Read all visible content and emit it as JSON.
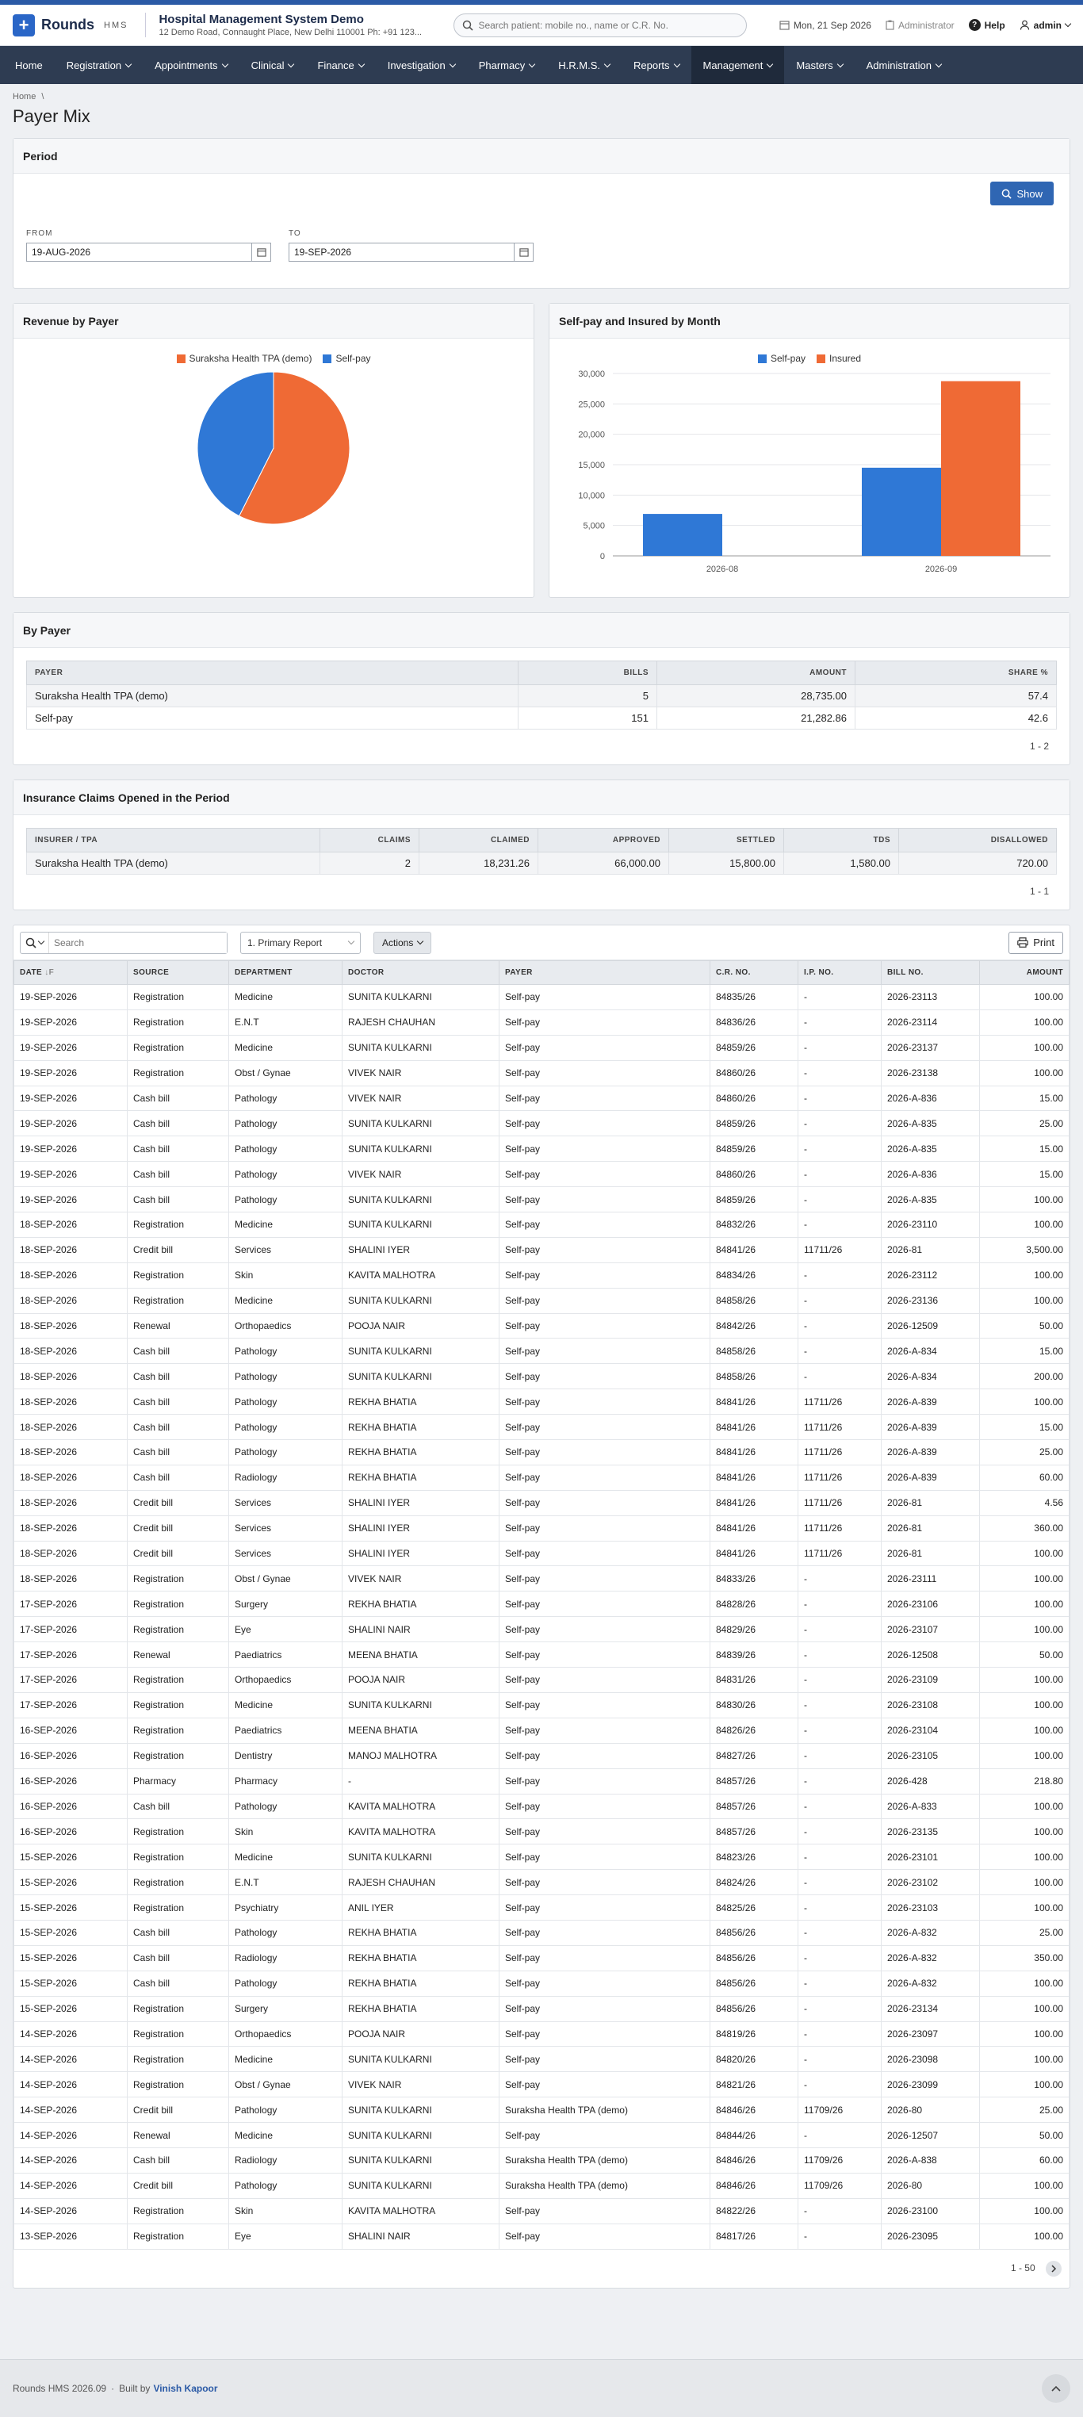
{
  "app": {
    "name": "Rounds",
    "sub": "HMS",
    "org_name": "Hospital Management System Demo",
    "org_address": "12 Demo Road, Connaught Place, New Delhi 110001 Ph: +91 123...",
    "search_placeholder": "Search patient: mobile no., name or C.R. No.",
    "date": "Mon, 21 Sep 2026",
    "role": "Administrator",
    "help": "Help",
    "user": "admin"
  },
  "nav": [
    {
      "label": "Home",
      "dropdown": false
    },
    {
      "label": "Registration",
      "dropdown": true
    },
    {
      "label": "Appointments",
      "dropdown": true
    },
    {
      "label": "Clinical",
      "dropdown": true
    },
    {
      "label": "Finance",
      "dropdown": true
    },
    {
      "label": "Investigation",
      "dropdown": true
    },
    {
      "label": "Pharmacy",
      "dropdown": true
    },
    {
      "label": "H.R.M.S.",
      "dropdown": true
    },
    {
      "label": "Reports",
      "dropdown": true
    },
    {
      "label": "Management",
      "dropdown": true,
      "active": true
    },
    {
      "label": "Masters",
      "dropdown": true
    },
    {
      "label": "Administration",
      "dropdown": true
    }
  ],
  "breadcrumb": {
    "home": "Home",
    "sep": "\\"
  },
  "page_title": "Payer Mix",
  "period": {
    "title": "Period",
    "show_label": "Show",
    "from_label": "FROM",
    "from_value": "19-AUG-2026",
    "to_label": "TO",
    "to_value": "19-SEP-2026"
  },
  "charts": {
    "revenue_title": "Revenue by Payer",
    "monthly_title": "Self-pay and Insured by Month"
  },
  "chart_data": [
    {
      "type": "pie",
      "labels": [
        "Suraksha Health TPA (demo)",
        "Self-pay"
      ],
      "values": [
        28735.0,
        21282.86
      ],
      "colors": [
        "#ef6a35",
        "#2f78d6"
      ],
      "legend": "top"
    },
    {
      "type": "bar",
      "categories": [
        "2026-08",
        "2026-09"
      ],
      "series": [
        {
          "name": "Self-pay",
          "values": [
            6900,
            14500
          ],
          "color": "#2f78d6"
        },
        {
          "name": "Insured",
          "values": [
            0,
            28735
          ],
          "color": "#ef6a35"
        }
      ],
      "ylim": [
        0,
        30000
      ],
      "yticks": [
        "0",
        "5,000",
        "10,000",
        "15,000",
        "20,000",
        "25,000",
        "30,000"
      ],
      "grid": true,
      "legend": "top"
    }
  ],
  "by_payer": {
    "title": "By Payer",
    "headers": [
      "PAYER",
      "BILLS",
      "AMOUNT",
      "SHARE %"
    ],
    "rows": [
      [
        "Suraksha Health TPA (demo)",
        "5",
        "28,735.00",
        "57.4"
      ],
      [
        "Self-pay",
        "151",
        "21,282.86",
        "42.6"
      ]
    ],
    "pager": "1 - 2"
  },
  "claims": {
    "title": "Insurance Claims Opened in the Period",
    "headers": [
      "INSURER / TPA",
      "CLAIMS",
      "CLAIMED",
      "APPROVED",
      "SETTLED",
      "TDS",
      "DISALLOWED"
    ],
    "rows": [
      [
        "Suraksha Health TPA (demo)",
        "2",
        "18,231.26",
        "66,000.00",
        "15,800.00",
        "1,580.00",
        "720.00"
      ]
    ],
    "pager": "1 - 1"
  },
  "toolbar": {
    "search_placeholder": "Search",
    "report_select": "1. Primary Report",
    "actions_label": "Actions",
    "print_label": "Print"
  },
  "detail": {
    "headers": [
      "DATE",
      "SOURCE",
      "DEPARTMENT",
      "DOCTOR",
      "PAYER",
      "C.R. NO.",
      "I.P. NO.",
      "BILL NO.",
      "AMOUNT"
    ],
    "sort_indicator": "↓F",
    "rows": [
      [
        "19-SEP-2026",
        "Registration",
        "Medicine",
        "SUNITA KULKARNI",
        "Self-pay",
        "84835/26",
        "-",
        "2026-23113",
        "100.00"
      ],
      [
        "19-SEP-2026",
        "Registration",
        "E.N.T",
        "RAJESH CHAUHAN",
        "Self-pay",
        "84836/26",
        "-",
        "2026-23114",
        "100.00"
      ],
      [
        "19-SEP-2026",
        "Registration",
        "Medicine",
        "SUNITA KULKARNI",
        "Self-pay",
        "84859/26",
        "-",
        "2026-23137",
        "100.00"
      ],
      [
        "19-SEP-2026",
        "Registration",
        "Obst / Gynae",
        "VIVEK NAIR",
        "Self-pay",
        "84860/26",
        "-",
        "2026-23138",
        "100.00"
      ],
      [
        "19-SEP-2026",
        "Cash bill",
        "Pathology",
        "VIVEK NAIR",
        "Self-pay",
        "84860/26",
        "-",
        "2026-A-836",
        "15.00"
      ],
      [
        "19-SEP-2026",
        "Cash bill",
        "Pathology",
        "SUNITA KULKARNI",
        "Self-pay",
        "84859/26",
        "-",
        "2026-A-835",
        "25.00"
      ],
      [
        "19-SEP-2026",
        "Cash bill",
        "Pathology",
        "SUNITA KULKARNI",
        "Self-pay",
        "84859/26",
        "-",
        "2026-A-835",
        "15.00"
      ],
      [
        "19-SEP-2026",
        "Cash bill",
        "Pathology",
        "VIVEK NAIR",
        "Self-pay",
        "84860/26",
        "-",
        "2026-A-836",
        "15.00"
      ],
      [
        "19-SEP-2026",
        "Cash bill",
        "Pathology",
        "SUNITA KULKARNI",
        "Self-pay",
        "84859/26",
        "-",
        "2026-A-835",
        "100.00"
      ],
      [
        "18-SEP-2026",
        "Registration",
        "Medicine",
        "SUNITA KULKARNI",
        "Self-pay",
        "84832/26",
        "-",
        "2026-23110",
        "100.00"
      ],
      [
        "18-SEP-2026",
        "Credit bill",
        "Services",
        "SHALINI IYER",
        "Self-pay",
        "84841/26",
        "11711/26",
        "2026-81",
        "3,500.00"
      ],
      [
        "18-SEP-2026",
        "Registration",
        "Skin",
        "KAVITA MALHOTRA",
        "Self-pay",
        "84834/26",
        "-",
        "2026-23112",
        "100.00"
      ],
      [
        "18-SEP-2026",
        "Registration",
        "Medicine",
        "SUNITA KULKARNI",
        "Self-pay",
        "84858/26",
        "-",
        "2026-23136",
        "100.00"
      ],
      [
        "18-SEP-2026",
        "Renewal",
        "Orthopaedics",
        "POOJA NAIR",
        "Self-pay",
        "84842/26",
        "-",
        "2026-12509",
        "50.00"
      ],
      [
        "18-SEP-2026",
        "Cash bill",
        "Pathology",
        "SUNITA KULKARNI",
        "Self-pay",
        "84858/26",
        "-",
        "2026-A-834",
        "15.00"
      ],
      [
        "18-SEP-2026",
        "Cash bill",
        "Pathology",
        "SUNITA KULKARNI",
        "Self-pay",
        "84858/26",
        "-",
        "2026-A-834",
        "200.00"
      ],
      [
        "18-SEP-2026",
        "Cash bill",
        "Pathology",
        "REKHA BHATIA",
        "Self-pay",
        "84841/26",
        "11711/26",
        "2026-A-839",
        "100.00"
      ],
      [
        "18-SEP-2026",
        "Cash bill",
        "Pathology",
        "REKHA BHATIA",
        "Self-pay",
        "84841/26",
        "11711/26",
        "2026-A-839",
        "15.00"
      ],
      [
        "18-SEP-2026",
        "Cash bill",
        "Pathology",
        "REKHA BHATIA",
        "Self-pay",
        "84841/26",
        "11711/26",
        "2026-A-839",
        "25.00"
      ],
      [
        "18-SEP-2026",
        "Cash bill",
        "Radiology",
        "REKHA BHATIA",
        "Self-pay",
        "84841/26",
        "11711/26",
        "2026-A-839",
        "60.00"
      ],
      [
        "18-SEP-2026",
        "Credit bill",
        "Services",
        "SHALINI IYER",
        "Self-pay",
        "84841/26",
        "11711/26",
        "2026-81",
        "4.56"
      ],
      [
        "18-SEP-2026",
        "Credit bill",
        "Services",
        "SHALINI IYER",
        "Self-pay",
        "84841/26",
        "11711/26",
        "2026-81",
        "360.00"
      ],
      [
        "18-SEP-2026",
        "Credit bill",
        "Services",
        "SHALINI IYER",
        "Self-pay",
        "84841/26",
        "11711/26",
        "2026-81",
        "100.00"
      ],
      [
        "18-SEP-2026",
        "Registration",
        "Obst / Gynae",
        "VIVEK NAIR",
        "Self-pay",
        "84833/26",
        "-",
        "2026-23111",
        "100.00"
      ],
      [
        "17-SEP-2026",
        "Registration",
        "Surgery",
        "REKHA BHATIA",
        "Self-pay",
        "84828/26",
        "-",
        "2026-23106",
        "100.00"
      ],
      [
        "17-SEP-2026",
        "Registration",
        "Eye",
        "SHALINI NAIR",
        "Self-pay",
        "84829/26",
        "-",
        "2026-23107",
        "100.00"
      ],
      [
        "17-SEP-2026",
        "Renewal",
        "Paediatrics",
        "MEENA BHATIA",
        "Self-pay",
        "84839/26",
        "-",
        "2026-12508",
        "50.00"
      ],
      [
        "17-SEP-2026",
        "Registration",
        "Orthopaedics",
        "POOJA NAIR",
        "Self-pay",
        "84831/26",
        "-",
        "2026-23109",
        "100.00"
      ],
      [
        "17-SEP-2026",
        "Registration",
        "Medicine",
        "SUNITA KULKARNI",
        "Self-pay",
        "84830/26",
        "-",
        "2026-23108",
        "100.00"
      ],
      [
        "16-SEP-2026",
        "Registration",
        "Paediatrics",
        "MEENA BHATIA",
        "Self-pay",
        "84826/26",
        "-",
        "2026-23104",
        "100.00"
      ],
      [
        "16-SEP-2026",
        "Registration",
        "Dentistry",
        "MANOJ MALHOTRA",
        "Self-pay",
        "84827/26",
        "-",
        "2026-23105",
        "100.00"
      ],
      [
        "16-SEP-2026",
        "Pharmacy",
        "Pharmacy",
        "-",
        "Self-pay",
        "84857/26",
        "-",
        "2026-428",
        "218.80"
      ],
      [
        "16-SEP-2026",
        "Cash bill",
        "Pathology",
        "KAVITA MALHOTRA",
        "Self-pay",
        "84857/26",
        "-",
        "2026-A-833",
        "100.00"
      ],
      [
        "16-SEP-2026",
        "Registration",
        "Skin",
        "KAVITA MALHOTRA",
        "Self-pay",
        "84857/26",
        "-",
        "2026-23135",
        "100.00"
      ],
      [
        "15-SEP-2026",
        "Registration",
        "Medicine",
        "SUNITA KULKARNI",
        "Self-pay",
        "84823/26",
        "-",
        "2026-23101",
        "100.00"
      ],
      [
        "15-SEP-2026",
        "Registration",
        "E.N.T",
        "RAJESH CHAUHAN",
        "Self-pay",
        "84824/26",
        "-",
        "2026-23102",
        "100.00"
      ],
      [
        "15-SEP-2026",
        "Registration",
        "Psychiatry",
        "ANIL IYER",
        "Self-pay",
        "84825/26",
        "-",
        "2026-23103",
        "100.00"
      ],
      [
        "15-SEP-2026",
        "Cash bill",
        "Pathology",
        "REKHA BHATIA",
        "Self-pay",
        "84856/26",
        "-",
        "2026-A-832",
        "25.00"
      ],
      [
        "15-SEP-2026",
        "Cash bill",
        "Radiology",
        "REKHA BHATIA",
        "Self-pay",
        "84856/26",
        "-",
        "2026-A-832",
        "350.00"
      ],
      [
        "15-SEP-2026",
        "Cash bill",
        "Pathology",
        "REKHA BHATIA",
        "Self-pay",
        "84856/26",
        "-",
        "2026-A-832",
        "100.00"
      ],
      [
        "15-SEP-2026",
        "Registration",
        "Surgery",
        "REKHA BHATIA",
        "Self-pay",
        "84856/26",
        "-",
        "2026-23134",
        "100.00"
      ],
      [
        "14-SEP-2026",
        "Registration",
        "Orthopaedics",
        "POOJA NAIR",
        "Self-pay",
        "84819/26",
        "-",
        "2026-23097",
        "100.00"
      ],
      [
        "14-SEP-2026",
        "Registration",
        "Medicine",
        "SUNITA KULKARNI",
        "Self-pay",
        "84820/26",
        "-",
        "2026-23098",
        "100.00"
      ],
      [
        "14-SEP-2026",
        "Registration",
        "Obst / Gynae",
        "VIVEK NAIR",
        "Self-pay",
        "84821/26",
        "-",
        "2026-23099",
        "100.00"
      ],
      [
        "14-SEP-2026",
        "Credit bill",
        "Pathology",
        "SUNITA KULKARNI",
        "Suraksha Health TPA (demo)",
        "84846/26",
        "11709/26",
        "2026-80",
        "25.00"
      ],
      [
        "14-SEP-2026",
        "Renewal",
        "Medicine",
        "SUNITA KULKARNI",
        "Self-pay",
        "84844/26",
        "-",
        "2026-12507",
        "50.00"
      ],
      [
        "14-SEP-2026",
        "Cash bill",
        "Radiology",
        "SUNITA KULKARNI",
        "Suraksha Health TPA (demo)",
        "84846/26",
        "11709/26",
        "2026-A-838",
        "60.00"
      ],
      [
        "14-SEP-2026",
        "Credit bill",
        "Pathology",
        "SUNITA KULKARNI",
        "Suraksha Health TPA (demo)",
        "84846/26",
        "11709/26",
        "2026-80",
        "100.00"
      ],
      [
        "14-SEP-2026",
        "Registration",
        "Skin",
        "KAVITA MALHOTRA",
        "Self-pay",
        "84822/26",
        "-",
        "2026-23100",
        "100.00"
      ],
      [
        "13-SEP-2026",
        "Registration",
        "Eye",
        "SHALINI NAIR",
        "Self-pay",
        "84817/26",
        "-",
        "2026-23095",
        "100.00"
      ]
    ],
    "pager": "1 - 50"
  },
  "footer": {
    "version": "Rounds HMS 2026.09",
    "built_by": "Built by",
    "author": "Vinish Kapoor"
  }
}
